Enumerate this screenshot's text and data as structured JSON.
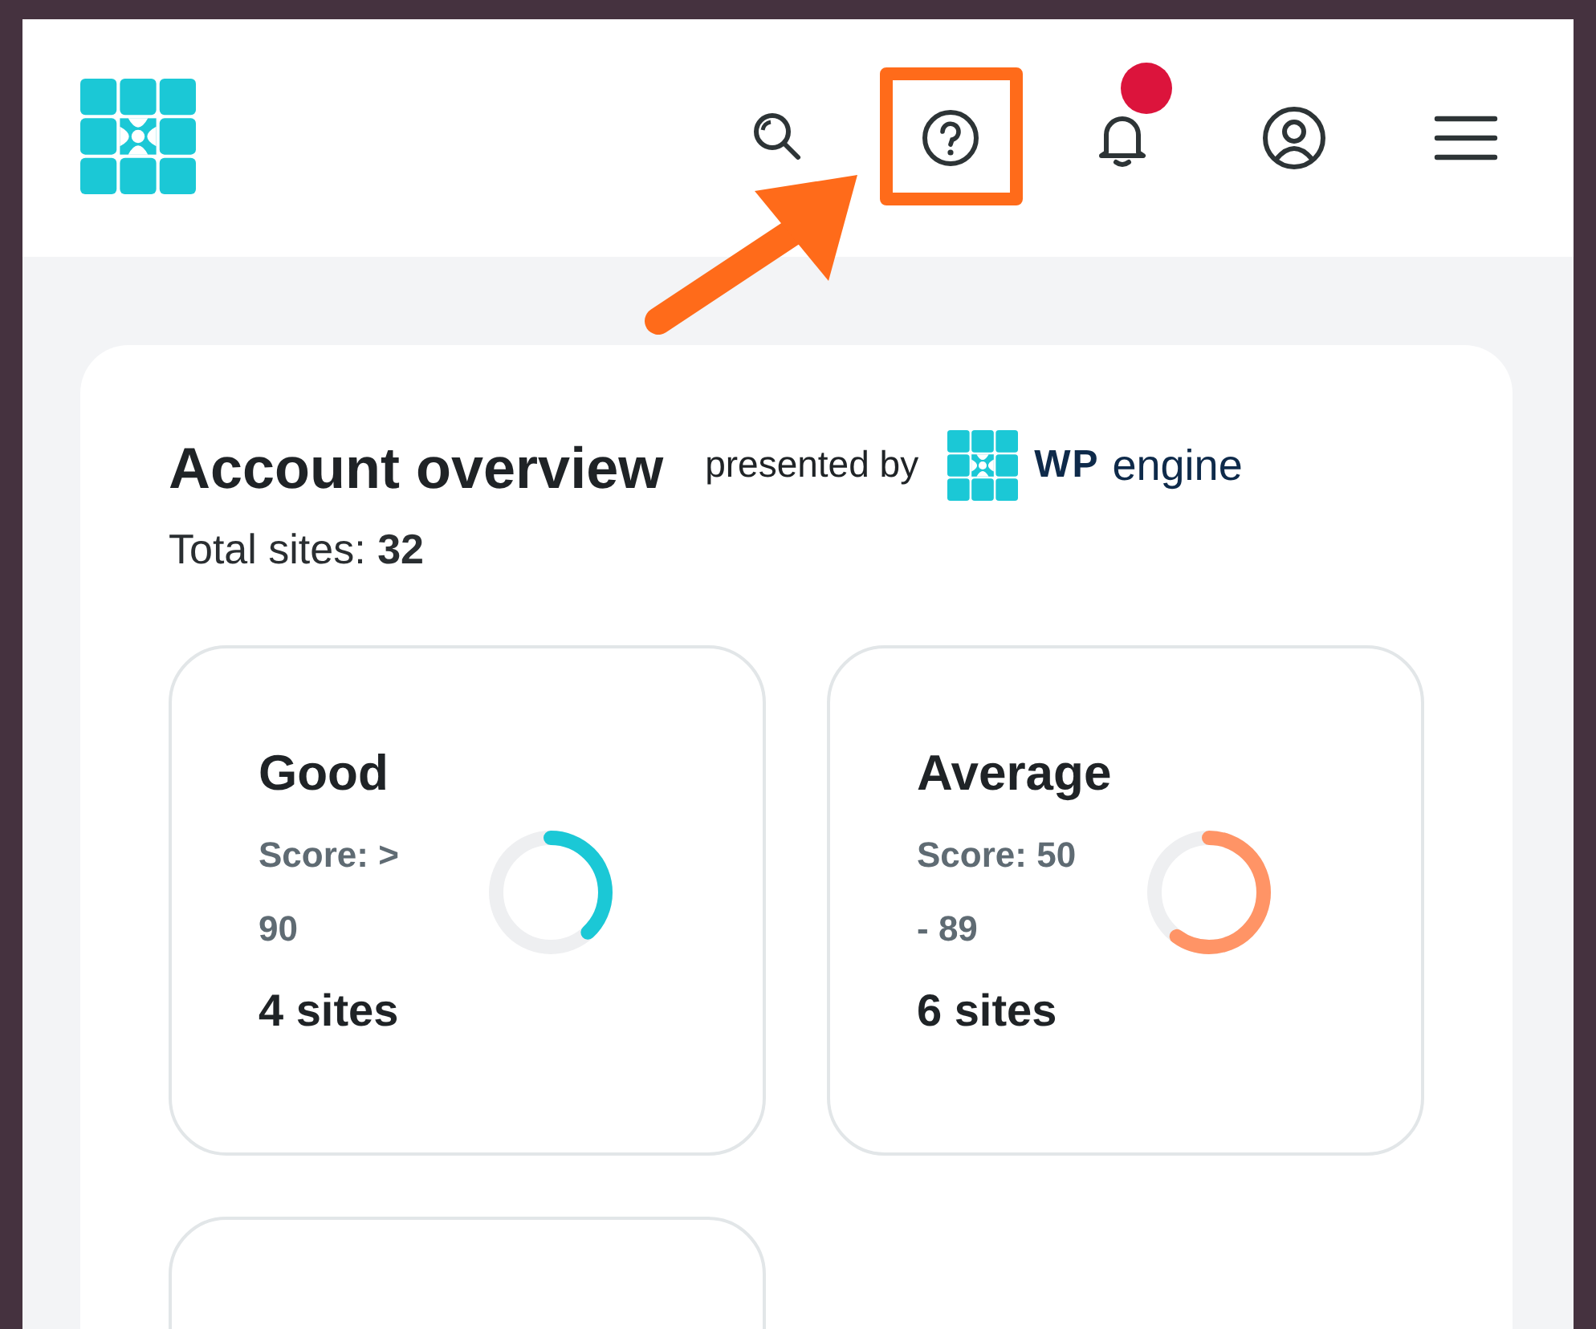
{
  "header": {
    "icons": [
      {
        "kind": "search",
        "highlighted": false,
        "dot": false
      },
      {
        "kind": "help",
        "highlighted": true,
        "dot": false
      },
      {
        "kind": "bell",
        "highlighted": false,
        "dot": true
      },
      {
        "kind": "user",
        "highlighted": false,
        "dot": false
      },
      {
        "kind": "menu",
        "highlighted": false,
        "dot": false
      }
    ]
  },
  "overview": {
    "title": "Account overview",
    "presented_by": "presented by",
    "brand": [
      "WP",
      "engine"
    ],
    "total_label": "Total sites: ",
    "total_value": "32",
    "cards": [
      {
        "kind": "score",
        "title": "Good",
        "score": "Score: > 90",
        "sites": "4 sites",
        "level": 0.38,
        "color": "#1bc8d6"
      },
      {
        "kind": "score",
        "title": "Average",
        "score": "Score: 50 - 89",
        "sites": "6 sites",
        "level": 0.6,
        "color": "#ff9466"
      },
      {
        "kind": "blank"
      }
    ]
  }
}
